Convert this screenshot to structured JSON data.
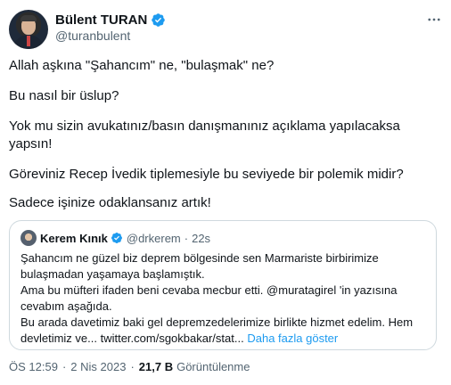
{
  "author": {
    "display_name": "Bülent TURAN",
    "handle": "@turanbulent",
    "verified": true
  },
  "tweet": {
    "paragraphs": [
      "Allah aşkına \"Şahancım\" ne, \"bulaşmak\" ne?",
      "Bu nasıl bir üslup?",
      "Yok mu sizin avukatınız/basın danışmanınız açıklama yapılacaksa yapsın!",
      "Göreviniz Recep İvedik tiplemesiyle bu seviyede bir polemik midir?",
      "Sadece işinize odaklansanız artık!"
    ],
    "p3_line1": "Yok mu sizin avukatınız/basın danışmanınız açıklama yapılacaksa",
    "p3_line2": "yapsın!"
  },
  "quoted_tweet": {
    "display_name": "Kerem Kınık",
    "handle": "@drkerem",
    "separator": "·",
    "time": "22s",
    "lines": [
      "Şahancım ne güzel biz deprem bölgesinde sen Marmariste birbirimize",
      "bulaşmadan yaşamaya başlamıştık.",
      "Ama bu müfteri ifaden beni cevaba mecbur etti. @muratagirel 'in yazısına",
      "cevabım aşağıda.",
      "Bu arada davetimiz baki gel depremzedelerimize birlikte hizmet edelim. Hem"
    ],
    "line3_pre": "Ama bu müfteri ifaden beni cevaba mecbur etti. ",
    "line3_mention": "@muratagirel",
    "line3_post": " 'in yazısına",
    "last_line_text": "devletimiz ve... ",
    "last_line_url": "twitter.com/sgokbakar/stat...",
    "show_more": "Daha fazla göster"
  },
  "meta": {
    "time": "ÖS 12:59",
    "separator": "·",
    "date": "2 Nis 2023",
    "views_count": "21,7 B",
    "views_label": "Görüntülenme"
  },
  "icons": {
    "verified": "verified-badge-icon",
    "more": "more-options-icon"
  },
  "colors": {
    "accent": "#1d9bf0",
    "text": "#0f1419",
    "secondary": "#536471",
    "border": "#cfd9de"
  }
}
